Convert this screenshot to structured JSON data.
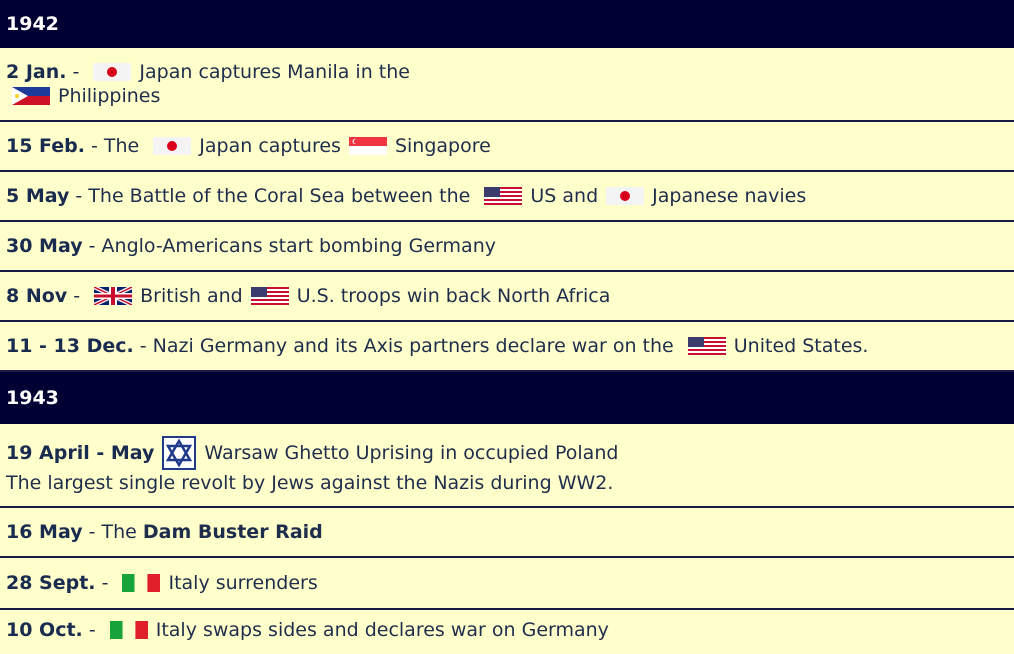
{
  "y1942": {
    "header": "1942",
    "events": [
      {
        "date": "2 Jan.",
        "sep": " - ",
        "text1": "Japan captures Manila in the",
        "text2": "Philippines"
      },
      {
        "date": "15 Feb.",
        "sep": " - The ",
        "text1": "Japan captures",
        "text2": "Singapore"
      },
      {
        "date": "5 May",
        "sep": " - The Battle of the Coral Sea between the ",
        "text1": "US and",
        "text2": "Japanese navies"
      },
      {
        "date": "30 May",
        "text": " - Anglo-Americans start bombing Germany"
      },
      {
        "date": "8 Nov",
        "sep": " - ",
        "text1": "British and",
        "text2": "U.S. troops win back North Africa"
      },
      {
        "date": "11 - 13 Dec.",
        "sep": " - Nazi Germany and its Axis partners declare war on the ",
        "text1": "United States."
      }
    ]
  },
  "y1943": {
    "header": "1943",
    "events": [
      {
        "date": "19 April - May",
        "text1": "Warsaw Ghetto Uprising in occupied Poland",
        "text2": "The largest single revolt by Jews against the Nazis during WW2."
      },
      {
        "date": "16 May",
        "sep": " - The ",
        "bold": "Dam Buster Raid"
      },
      {
        "date": "28 Sept.",
        "sep": " - ",
        "text1": "Italy surrenders"
      },
      {
        "date": "10 Oct.",
        "sep": " - ",
        "text1": "Italy swaps sides and declares war on Germany"
      }
    ]
  },
  "icons": {
    "japan": "japan-flag-icon",
    "philippines": "philippines-flag-icon",
    "singapore": "singapore-flag-icon",
    "usa": "usa-flag-icon",
    "uk": "uk-flag-icon",
    "italy": "italy-flag-icon",
    "star": "star-of-david-icon"
  },
  "colors": {
    "header_bg": "#000033",
    "row_bg": "#ffffcc",
    "border": "#1a1a4a",
    "text": "#1f2d4d"
  }
}
